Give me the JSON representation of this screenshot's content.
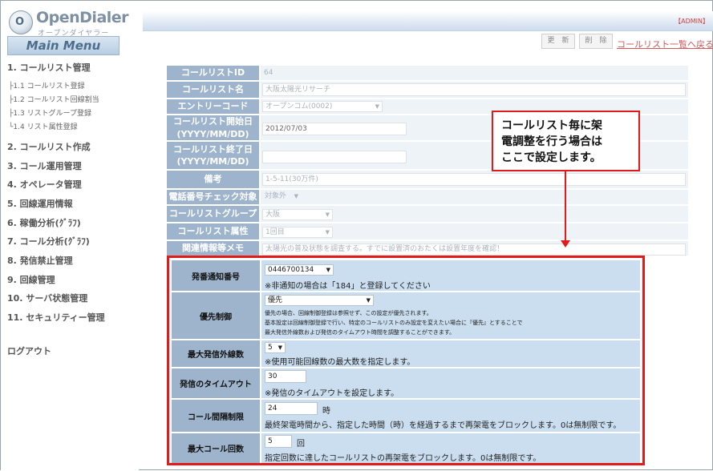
{
  "app": {
    "logo_letter": "O",
    "title": "OpenDialer",
    "subtitle": "オープンダイヤラー"
  },
  "sidebar": {
    "main_menu": "Main Menu",
    "items": [
      {
        "label": "1. コールリスト管理"
      },
      {
        "label": "2. コールリスト作成"
      },
      {
        "label": "3. コール運用管理"
      },
      {
        "label": "4. オペレータ管理"
      },
      {
        "label": "5. 回線運用情報"
      },
      {
        "label": "6. 稼働分析(ｸﾞﾗﾌ)"
      },
      {
        "label": "7. コール分析(ｸﾞﾗﾌ)"
      },
      {
        "label": "8. 発信禁止管理"
      },
      {
        "label": "9. 回線管理"
      },
      {
        "label": "10. サーバ状態管理"
      },
      {
        "label": "11. セキュリティー管理"
      }
    ],
    "sub_items": [
      {
        "label": "├1.1 コールリスト登録"
      },
      {
        "label": "├1.2 コールリスト回線割当"
      },
      {
        "label": "├1.3 リストグループ登録"
      },
      {
        "label": "└1.4 リスト属性登録"
      }
    ],
    "logout": "ログアウト"
  },
  "header": {
    "admin": "【ADMIN】"
  },
  "toolbar": {
    "update": "更　新",
    "delete": "削　除",
    "back": "コールリスト一覧へ戻る"
  },
  "form_upper": {
    "call_list_id": {
      "label": "コールリストID",
      "value": "64"
    },
    "call_list_name": {
      "label": "コールリスト名",
      "value": "大阪太陽光リサーチ"
    },
    "entry_code": {
      "label": "エントリーコード",
      "value": "オープンコム(0002)"
    },
    "start_date": {
      "label1": "コールリスト開始日",
      "label2": "(YYYY/MM/DD)",
      "value": "2012/07/03"
    },
    "end_date": {
      "label1": "コールリスト終了日",
      "label2": "(YYYY/MM/DD)",
      "value": ""
    },
    "remarks": {
      "label": "備考",
      "value": "1-5-11(30万件)"
    },
    "phone_check": {
      "label": "電話番号チェック対象",
      "value": "対象外"
    },
    "group": {
      "label": "コールリストグループ",
      "value": "大阪"
    },
    "attribute": {
      "label": "コールリスト属性",
      "value": "1回目"
    },
    "memo": {
      "label": "関連情報等メモ",
      "value": "太陽光の普及状態を調査する。すでに設置済のおたくは設置年度を確認！"
    }
  },
  "form_lower": {
    "caller_number": {
      "label": "発番通知番号",
      "value": "0446700134",
      "note": "※非通知の場合は「184」と登録してください"
    },
    "priority": {
      "label": "優先制御",
      "value": "優先",
      "notes": [
        "優先の場合、回線制御登録は参照せず、この設定が優先されます。",
        "基本設定は回線制御登録で行い、特定のコールリストのみ設定を変えたい場合に『優先』とすることで",
        "最大発信外線数および発信のタイムアウト時間を調整することができます。"
      ]
    },
    "max_lines": {
      "label": "最大発信外線数",
      "value": "5",
      "note": "※使用可能回線数の最大数を指定します。"
    },
    "timeout": {
      "label": "発信のタイムアウト",
      "value": "30",
      "note": "※発信のタイムアウトを設定します。"
    },
    "interval": {
      "label": "コール間隔制限",
      "value": "24",
      "unit": "時",
      "note": "最終架電時間から、指定した時間（時）を経過するまで再架電をブロックします。0は無制限です。"
    },
    "max_calls": {
      "label": "最大コール回数",
      "value": "5",
      "unit": "回",
      "note": "指定回数に達したコールリストの再架電をブロックします。0は無制限です。"
    }
  },
  "callout": {
    "lines": [
      "コールリスト毎に架",
      "電調整を行う場合は",
      "ここで設定します。"
    ]
  },
  "colors": {
    "accent_red": "#e21a1a",
    "label_blue": "#9db4cc",
    "highlight_value": "#cadef0"
  }
}
